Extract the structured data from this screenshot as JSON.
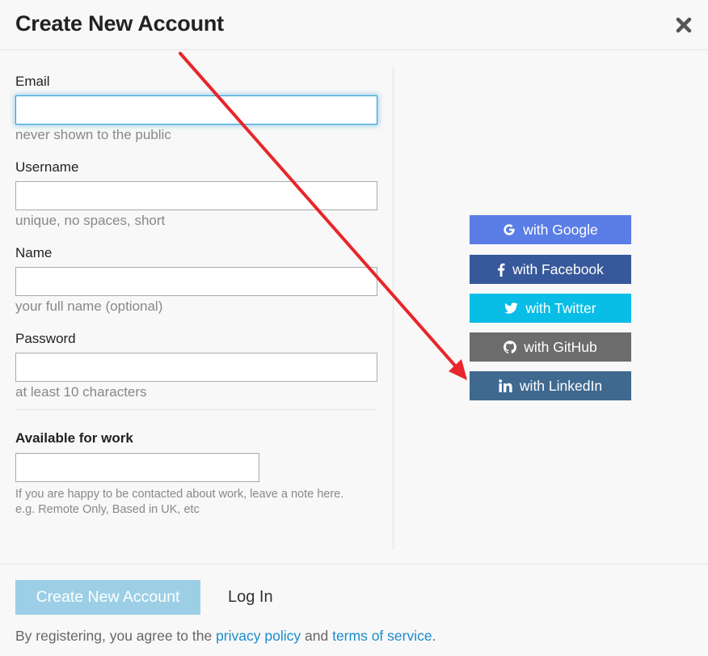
{
  "header": {
    "title": "Create New Account"
  },
  "form": {
    "email": {
      "label": "Email",
      "value": "",
      "hint": "never shown to the public"
    },
    "username": {
      "label": "Username",
      "value": "",
      "hint": "unique, no spaces, short"
    },
    "name": {
      "label": "Name",
      "value": "",
      "hint": "your full name (optional)"
    },
    "password": {
      "label": "Password",
      "value": "",
      "hint": "at least 10 characters"
    },
    "work": {
      "label": "Available for work",
      "value": "",
      "hint_line1": "If you are happy to be contacted about work, leave a note here.",
      "hint_line2": "e.g. Remote Only, Based in UK, etc"
    }
  },
  "social": {
    "google": {
      "label": "with Google",
      "color": "#5a7de6",
      "icon": "google-icon"
    },
    "facebook": {
      "label": "with Facebook",
      "color": "#37589a",
      "icon": "facebook-icon"
    },
    "twitter": {
      "label": "with Twitter",
      "color": "#08bde6",
      "icon": "twitter-icon"
    },
    "github": {
      "label": "with GitHub",
      "color": "#6c6c6c",
      "icon": "github-icon"
    },
    "linkedin": {
      "label": "with LinkedIn",
      "color": "#3f698f",
      "icon": "linkedin-icon"
    }
  },
  "footer": {
    "create_label": "Create New Account",
    "login_label": "Log In",
    "terms_prefix": "By registering, you agree to the",
    "privacy_link": "privacy policy",
    "terms_and": "and",
    "tos_link": "terms of service",
    "terms_suffix": "."
  },
  "annotation": {
    "arrow_color": "#e8262b"
  }
}
